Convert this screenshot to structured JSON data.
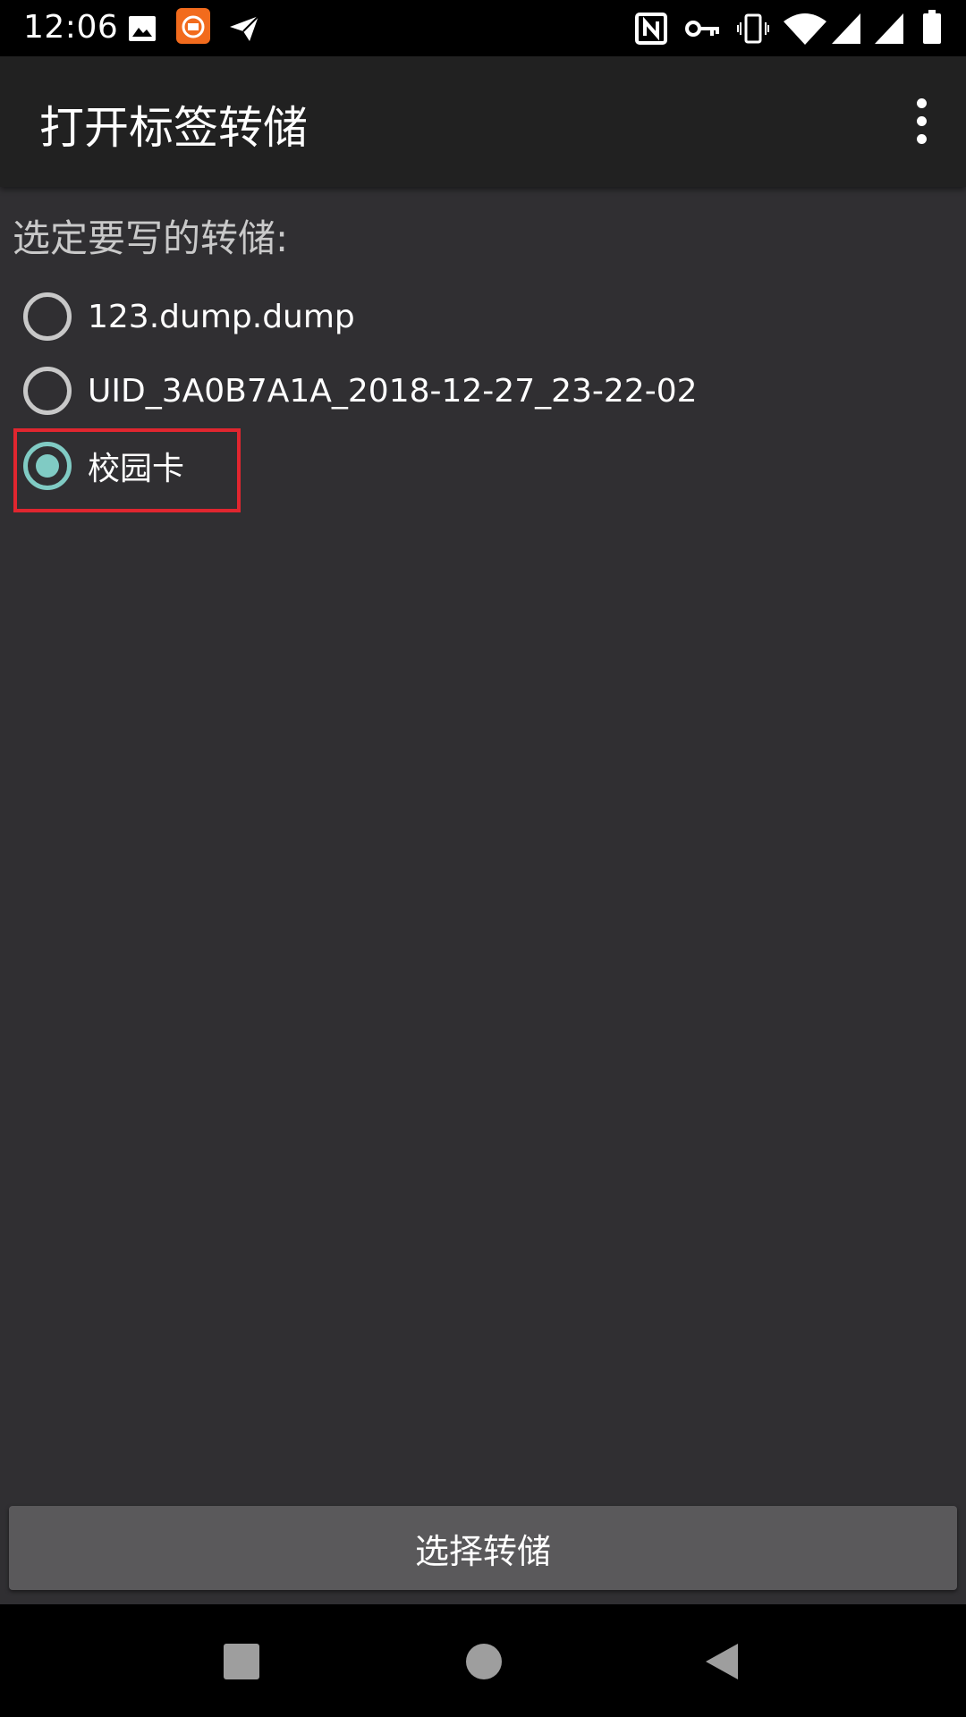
{
  "status_bar": {
    "time": "12:06",
    "icons": [
      "image-icon",
      "mi-app-icon",
      "send-icon",
      "nfc-icon",
      "key-icon",
      "vibrate-icon",
      "wifi-icon",
      "signal-icon",
      "signal-icon-2",
      "battery-icon"
    ]
  },
  "app_bar": {
    "title": "打开标签转储",
    "menu_icon": "more-vert-icon"
  },
  "content": {
    "prompt": "选定要写的转储:",
    "options": [
      {
        "label": "123.dump.dump",
        "checked": false
      },
      {
        "label": "UID_3A0B7A1A_2018-12-27_23-22-02",
        "checked": false
      },
      {
        "label": "校园卡",
        "checked": true
      }
    ],
    "accent_color": "#80cbc4",
    "highlight_color": "#e0262f"
  },
  "footer": {
    "select_button_label": "选择转储"
  },
  "nav_bar": {
    "icons": [
      "recents-square-icon",
      "home-circle-icon",
      "back-triangle-icon"
    ]
  }
}
